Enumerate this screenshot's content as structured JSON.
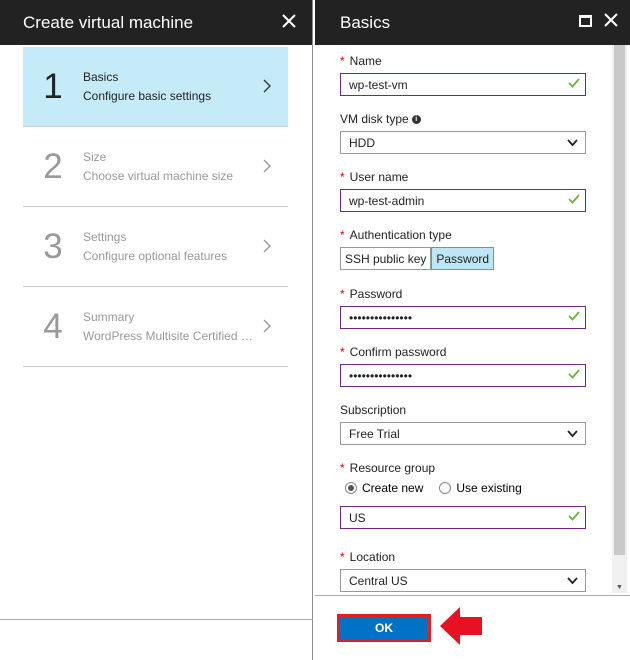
{
  "left_blade": {
    "title": "Create virtual machine",
    "steps": [
      {
        "number": "1",
        "title": "Basics",
        "subtitle": "Configure basic settings",
        "active": true
      },
      {
        "number": "2",
        "title": "Size",
        "subtitle": "Choose virtual machine size",
        "active": false
      },
      {
        "number": "3",
        "title": "Settings",
        "subtitle": "Configure optional features",
        "active": false
      },
      {
        "number": "4",
        "title": "Summary",
        "subtitle": "WordPress Multisite Certified b…",
        "active": false
      }
    ]
  },
  "right_blade": {
    "title": "Basics",
    "name": {
      "label": "Name",
      "value": "wp-test-vm"
    },
    "disk_type": {
      "label": "VM disk type",
      "value": "HDD"
    },
    "user_name": {
      "label": "User name",
      "value": "wp-test-admin"
    },
    "auth_type": {
      "label": "Authentication type",
      "options": [
        "SSH public key",
        "Password"
      ],
      "selected": "Password"
    },
    "password": {
      "label": "Password",
      "value": "•••••••••••••••"
    },
    "confirm_password": {
      "label": "Confirm password",
      "value": "•••••••••••••••"
    },
    "subscription": {
      "label": "Subscription",
      "value": "Free Trial"
    },
    "resource_group": {
      "label": "Resource group",
      "options": [
        "Create new",
        "Use existing"
      ],
      "selected": "Create new",
      "value": "US"
    },
    "location": {
      "label": "Location",
      "value": "Central US"
    },
    "ok_label": "OK"
  },
  "colors": {
    "header_bg": "#222222",
    "active_step_bg": "#c5ebf8",
    "input_border": "#6d2a87",
    "ok_button": "#0072c6",
    "highlight": "#e02020",
    "check": "#6db33f"
  },
  "icons": [
    "close-icon",
    "maximize-icon",
    "chevron-right-icon",
    "chevron-down-icon",
    "check-icon",
    "info-icon",
    "arrow-left-icon"
  ]
}
